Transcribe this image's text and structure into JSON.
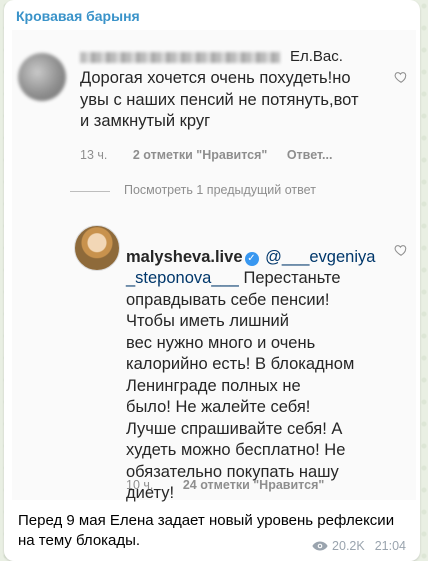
{
  "channel": {
    "name": "Кровавая барыня"
  },
  "comment1": {
    "author_tail": "Ел.Вас.",
    "text": "Дорогая хочется очень похудеть!но\nувы с наших пенсий не потянуть,вот\nи замкнутый круг",
    "time": "13 ч.",
    "likes": "2 отметки \"Нравится\"",
    "reply": "Ответ..."
  },
  "view_previous": "Посмотреть 1 предыдущий ответ",
  "comment2": {
    "author": "malysheva.live",
    "mention": "@___evgeniya\n_steponova___",
    "text": "Перестаньте\nоправдывать себе пенсии!\nЧтобы иметь лишний\nвес нужно много и очень\nкалорийно есть! В блокадном\nЛенинграде полных не\nбыло! Не жалейте себя!\nЛучше спрашивайте себя! А\nхудеть можно бесплатно! Не\nобязательно покупать нашу\nдиету!",
    "time": "10 ч.",
    "likes": "24 отметки \"Нравится\""
  },
  "caption": "Перед 9 мая Елена задает новый уровень рефлексии на тему блокады.",
  "message_meta": {
    "views": "20.2K",
    "time": "21:04"
  },
  "colors": {
    "accent": "#3a93c9",
    "verified": "#3897f0"
  }
}
